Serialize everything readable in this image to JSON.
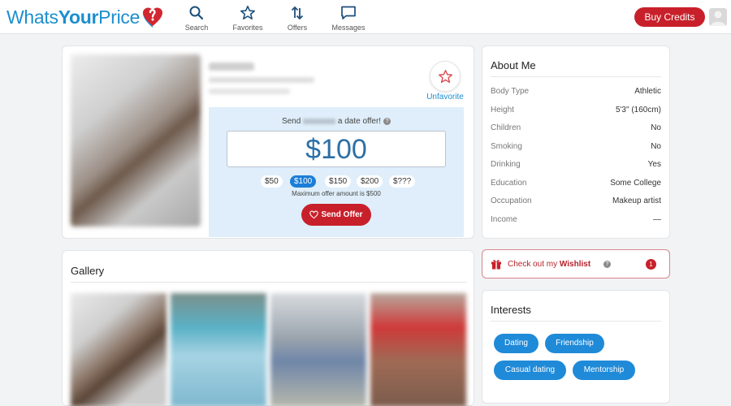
{
  "header": {
    "logo_part1": "Whats",
    "logo_part2": "Your",
    "logo_part3": "Price",
    "nav": [
      {
        "label": "Search",
        "icon": "search-icon"
      },
      {
        "label": "Favorites",
        "icon": "star-icon"
      },
      {
        "label": "Offers",
        "icon": "offers-arrows-icon"
      },
      {
        "label": "Messages",
        "icon": "message-icon"
      }
    ],
    "buy_credits": "Buy Credits"
  },
  "profile": {
    "unfavorite_label": "Unfavorite",
    "offer_prompt_before": "Send",
    "offer_prompt_after": "a date offer!",
    "offer_currency": "$",
    "offer_amount": "100",
    "amount_chips": [
      "$50",
      "$100",
      "$150",
      "$200",
      "$???"
    ],
    "selected_chip": "$100",
    "max_note": "Maximum offer amount is $500",
    "send_offer": "Send Offer"
  },
  "about": {
    "title": "About Me",
    "rows": [
      {
        "key": "Body Type",
        "value": "Athletic"
      },
      {
        "key": "Height",
        "value": "5'3\" (160cm)"
      },
      {
        "key": "Children",
        "value": "No"
      },
      {
        "key": "Smoking",
        "value": "No"
      },
      {
        "key": "Drinking",
        "value": "Yes"
      },
      {
        "key": "Education",
        "value": "Some College"
      },
      {
        "key": "Occupation",
        "value": "Makeup artist"
      },
      {
        "key": "Income",
        "value": "—"
      }
    ]
  },
  "wishlist": {
    "text_before": "Check out my",
    "text_bold": "Wishlist",
    "count": "1"
  },
  "interests": {
    "title": "Interests",
    "items": [
      "Dating",
      "Friendship",
      "Casual dating",
      "Mentorship"
    ]
  },
  "gallery": {
    "title": "Gallery"
  },
  "colors": {
    "brand_blue": "#1b8fcf",
    "brand_red": "#c8202a",
    "pill_blue": "#1f8ad8"
  }
}
